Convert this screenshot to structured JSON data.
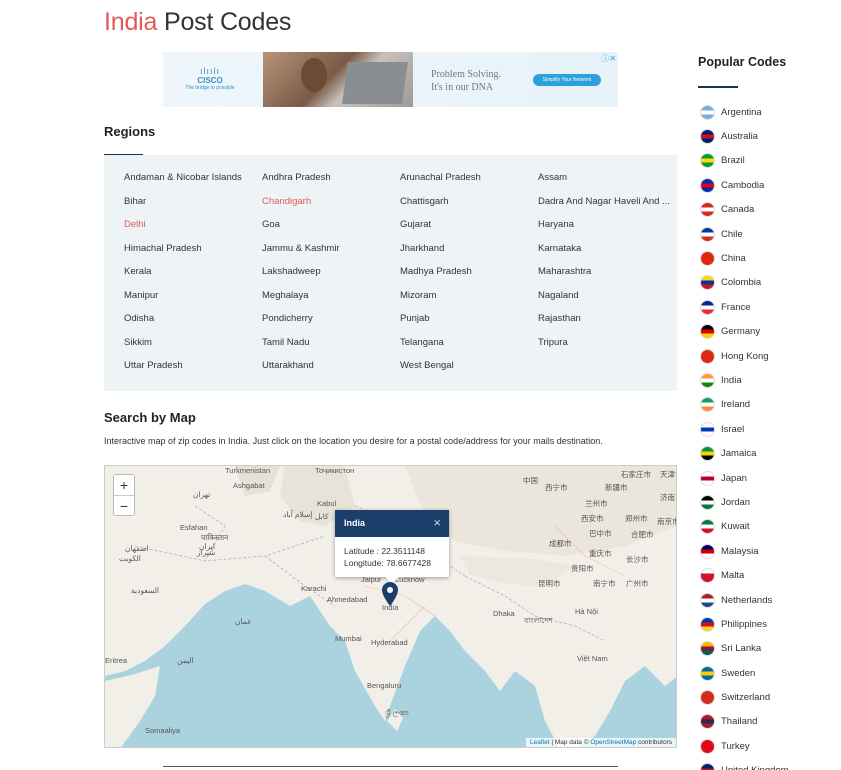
{
  "header": {
    "title_accent": "India",
    "title_rest": "Post Codes"
  },
  "ad": {
    "brand": "CISCO",
    "brand_bars": "ılıılı",
    "tagline": "The bridge to possible",
    "headline_1": "Problem Solving.",
    "headline_2": "It's in our DNA",
    "cta": "Simplify Your Network",
    "close": "ⓘ✕"
  },
  "regions": {
    "title": "Regions",
    "items": [
      {
        "label": "Andaman & Nicobar Islands",
        "active": false
      },
      {
        "label": "Andhra Pradesh",
        "active": false
      },
      {
        "label": "Arunachal Pradesh",
        "active": false
      },
      {
        "label": "Assam",
        "active": false
      },
      {
        "label": "Bihar",
        "active": false
      },
      {
        "label": "Chandigarh",
        "active": true
      },
      {
        "label": "Chattisgarh",
        "active": false
      },
      {
        "label": "Dadra And Nagar Haveli And ...",
        "active": false
      },
      {
        "label": "Delhi",
        "active": true
      },
      {
        "label": "Goa",
        "active": false
      },
      {
        "label": "Gujarat",
        "active": false
      },
      {
        "label": "Haryana",
        "active": false
      },
      {
        "label": "Himachal Pradesh",
        "active": false
      },
      {
        "label": "Jammu & Kashmir",
        "active": false
      },
      {
        "label": "Jharkhand",
        "active": false
      },
      {
        "label": "Karnataka",
        "active": false
      },
      {
        "label": "Kerala",
        "active": false
      },
      {
        "label": "Lakshadweep",
        "active": false
      },
      {
        "label": "Madhya Pradesh",
        "active": false
      },
      {
        "label": "Maharashtra",
        "active": false
      },
      {
        "label": "Manipur",
        "active": false
      },
      {
        "label": "Meghalaya",
        "active": false
      },
      {
        "label": "Mizoram",
        "active": false
      },
      {
        "label": "Nagaland",
        "active": false
      },
      {
        "label": "Odisha",
        "active": false
      },
      {
        "label": "Pondicherry",
        "active": false
      },
      {
        "label": "Punjab",
        "active": false
      },
      {
        "label": "Rajasthan",
        "active": false
      },
      {
        "label": "Sikkim",
        "active": false
      },
      {
        "label": "Tamil Nadu",
        "active": false
      },
      {
        "label": "Telangana",
        "active": false
      },
      {
        "label": "Tripura",
        "active": false
      },
      {
        "label": "Uttar Pradesh",
        "active": false
      },
      {
        "label": "Uttarakhand",
        "active": false
      },
      {
        "label": "West Bengal",
        "active": false
      }
    ]
  },
  "map_section": {
    "title": "Search by Map",
    "description": "Interactive map of zip codes in India. Just click on the location you desire for a postal code/address for your mails destination.",
    "zoom_in": "+",
    "zoom_out": "−",
    "popup": {
      "title": "India",
      "close": "×",
      "latitude": "Latitude : 22.3511148",
      "longitude": "Longitude: 78.6677428"
    },
    "attribution": {
      "leaflet": "Leaflet",
      "sep": " | Map data © ",
      "osm": "OpenStreetMap",
      "rest": " contributors"
    },
    "labels": [
      "Turkmenistan",
      "Тоҷикистон",
      "中国",
      "Ashgabat",
      "Kabul",
      "西宁市",
      "新疆市",
      "石家庄市",
      "天津市",
      "تهران",
      "کابل",
      "兰州市",
      "济南市",
      "Esfahan",
      "إسلام آباد",
      "西安市",
      "郑州市",
      "南京市",
      "ایران",
      "اصفهان",
      "पाकिस्तान",
      "成都市",
      "巴中市",
      "合肥市",
      "شيراز",
      "نپال",
      "重庆市",
      "الكويت",
      "Lahore",
      "贵阳市",
      "长沙市",
      "Jaipur",
      "Lucknow",
      "昆明市",
      "南宁市",
      "广州市",
      "Karachi",
      "Ahmedabad",
      "India",
      "Mumbai",
      "Hyderabad",
      "Bengaluru",
      "ශ්‍රී ලංකා",
      "Việt Nam",
      "Somaaliya",
      "Hà Nội",
      "Eritrea",
      "اليمن",
      "عمان",
      "السعودية",
      "Dhaka",
      "বাংলাদেশ"
    ]
  },
  "sidebar": {
    "title": "Popular Codes",
    "countries": [
      {
        "name": "Argentina",
        "colors": [
          "#74acdf",
          "#ffffff",
          "#74acdf"
        ]
      },
      {
        "name": "Australia",
        "colors": [
          "#012169",
          "#c8102e",
          "#012169"
        ]
      },
      {
        "name": "Brazil",
        "colors": [
          "#009c3b",
          "#ffdf00",
          "#009c3b"
        ]
      },
      {
        "name": "Cambodia",
        "colors": [
          "#032ea1",
          "#e00025",
          "#032ea1"
        ]
      },
      {
        "name": "Canada",
        "colors": [
          "#d52b1e",
          "#ffffff",
          "#d52b1e"
        ]
      },
      {
        "name": "Chile",
        "colors": [
          "#0039a6",
          "#ffffff",
          "#d52b1e"
        ]
      },
      {
        "name": "China",
        "colors": [
          "#de2910",
          "#de2910",
          "#de2910"
        ]
      },
      {
        "name": "Colombia",
        "colors": [
          "#fcd116",
          "#003893",
          "#ce1126"
        ]
      },
      {
        "name": "France",
        "colors": [
          "#002395",
          "#ffffff",
          "#ed2939"
        ]
      },
      {
        "name": "Germany",
        "colors": [
          "#000000",
          "#dd0000",
          "#ffce00"
        ]
      },
      {
        "name": "Hong Kong",
        "colors": [
          "#de2910",
          "#de2910",
          "#de2910"
        ]
      },
      {
        "name": "India",
        "colors": [
          "#ff9933",
          "#ffffff",
          "#138808"
        ]
      },
      {
        "name": "Ireland",
        "colors": [
          "#169b62",
          "#ffffff",
          "#ff883e"
        ]
      },
      {
        "name": "Israel",
        "colors": [
          "#ffffff",
          "#0038b8",
          "#ffffff"
        ]
      },
      {
        "name": "Jamaica",
        "colors": [
          "#009b3a",
          "#fed100",
          "#000000"
        ]
      },
      {
        "name": "Japan",
        "colors": [
          "#ffffff",
          "#bc002d",
          "#ffffff"
        ]
      },
      {
        "name": "Jordan",
        "colors": [
          "#000000",
          "#ffffff",
          "#007a3d"
        ]
      },
      {
        "name": "Kuwait",
        "colors": [
          "#007a3d",
          "#ffffff",
          "#ce1126"
        ]
      },
      {
        "name": "Malaysia",
        "colors": [
          "#010066",
          "#cc0001",
          "#ffffff"
        ]
      },
      {
        "name": "Malta",
        "colors": [
          "#ffffff",
          "#cf142b",
          "#cf142b"
        ]
      },
      {
        "name": "Netherlands",
        "colors": [
          "#ae1c28",
          "#ffffff",
          "#21468b"
        ]
      },
      {
        "name": "Philippines",
        "colors": [
          "#0038a8",
          "#ce1126",
          "#fcd116"
        ]
      },
      {
        "name": "Sri Lanka",
        "colors": [
          "#ffb700",
          "#8d153a",
          "#005f56"
        ]
      },
      {
        "name": "Sweden",
        "colors": [
          "#006aa7",
          "#fecc00",
          "#006aa7"
        ]
      },
      {
        "name": "Switzerland",
        "colors": [
          "#d52b1e",
          "#d52b1e",
          "#d52b1e"
        ]
      },
      {
        "name": "Thailand",
        "colors": [
          "#a51931",
          "#2d2a4a",
          "#a51931"
        ]
      },
      {
        "name": "Turkey",
        "colors": [
          "#e30a17",
          "#e30a17",
          "#e30a17"
        ]
      },
      {
        "name": "United Kingdom",
        "colors": [
          "#012169",
          "#c8102e",
          "#012169"
        ]
      }
    ]
  },
  "colors": {
    "accent": "#e05a5a",
    "navy": "#14365e",
    "region_bg": "#eef3f5",
    "popup_head": "#1b3e6b"
  }
}
